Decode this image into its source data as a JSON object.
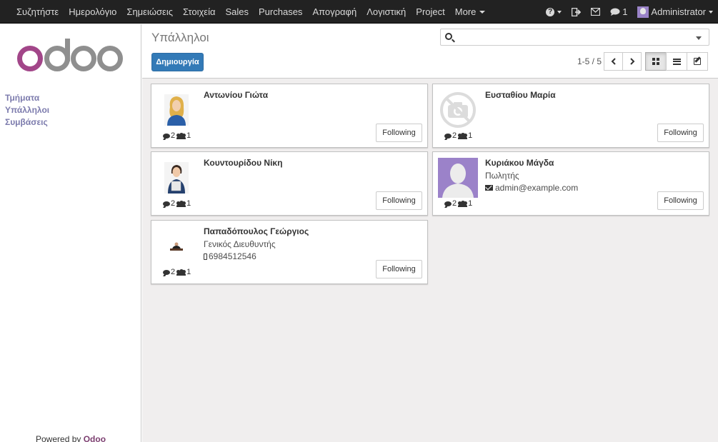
{
  "topbar": {
    "menu": [
      "Συζητήστε",
      "Ημερολόγιο",
      "Σημειώσεις",
      "Στοιχεία",
      "Sales",
      "Purchases",
      "Απογραφή",
      "Λογιστική",
      "Project",
      "More"
    ],
    "help_icon": "question-circle-icon",
    "messages_count": "1",
    "user": "Administrator"
  },
  "sidebar": {
    "logo_text": "odoo",
    "items": [
      "Τμήματα",
      "Υπάλληλοι",
      "Συμβάσεις"
    ],
    "powered_prefix": "Powered by",
    "powered_brand": "Odoo"
  },
  "control": {
    "title": "Υπάλληλοι",
    "create_label": "Δημιουργία",
    "search_placeholder": "",
    "pager": "1-5 / 5"
  },
  "colors": {
    "topbar": "#222222",
    "primary": "#337ab7",
    "sidebar_link": "#7c7bad",
    "brand": "#875a7b"
  },
  "employees": [
    {
      "name": "Αντωνίου Γιώτα",
      "job": "",
      "contact": "",
      "contact_type": "",
      "messages": "2",
      "followers": "1",
      "follow_label": "Following",
      "photo": "woman-blonde-photo"
    },
    {
      "name": "Ευσταθίου Μαρία",
      "job": "",
      "contact": "",
      "contact_type": "",
      "messages": "2",
      "followers": "1",
      "follow_label": "Following",
      "photo": "no-photo-placeholder"
    },
    {
      "name": "Κουντουρίδου Νίκη",
      "job": "",
      "contact": "",
      "contact_type": "",
      "messages": "2",
      "followers": "1",
      "follow_label": "Following",
      "photo": "woman-files-photo"
    },
    {
      "name": "Κυριάκου Μάγδα",
      "job": "Πωλητής",
      "contact": "admin@example.com",
      "contact_type": "email",
      "messages": "2",
      "followers": "1",
      "follow_label": "Following",
      "photo": "default-avatar"
    },
    {
      "name": "Παπαδόπουλος Γεώργιος",
      "job": "Γενικός Διευθυντής",
      "contact": "6984512546",
      "contact_type": "phone",
      "messages": "2",
      "followers": "1",
      "follow_label": "Following",
      "photo": "man-desk-photo"
    }
  ]
}
